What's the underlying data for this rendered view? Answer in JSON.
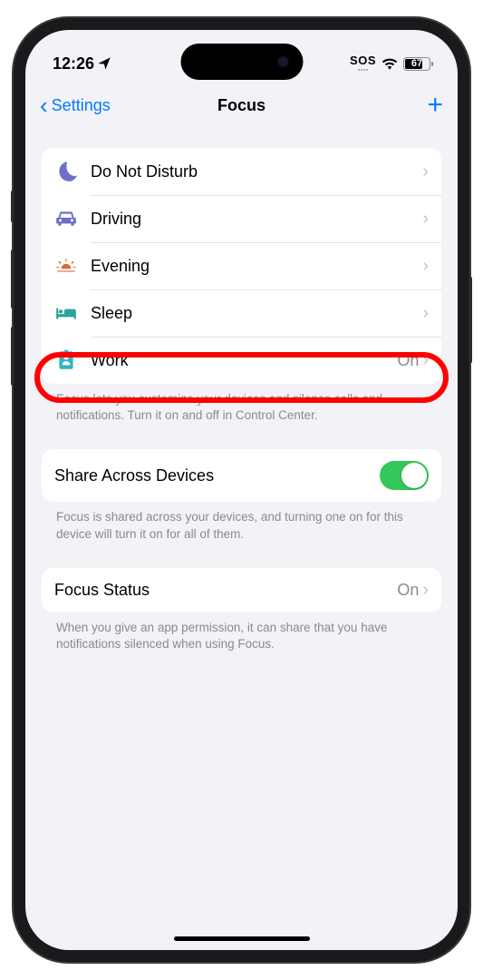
{
  "status_bar": {
    "time": "12:26",
    "sos": "SOS",
    "battery_percent": "67"
  },
  "nav": {
    "back_label": "Settings",
    "title": "Focus"
  },
  "focus_modes": [
    {
      "label": "Do Not Disturb",
      "status": ""
    },
    {
      "label": "Driving",
      "status": ""
    },
    {
      "label": "Evening",
      "status": ""
    },
    {
      "label": "Sleep",
      "status": ""
    },
    {
      "label": "Work",
      "status": "On"
    }
  ],
  "focus_footer": "Focus lets you customize your devices and silence calls and notifications. Turn it on and off in Control Center.",
  "share": {
    "label": "Share Across Devices",
    "footer": "Focus is shared across your devices, and turning one on for this device will turn it on for all of them."
  },
  "focus_status": {
    "label": "Focus Status",
    "value": "On",
    "footer": "When you give an app permission, it can share that you have notifications silenced when using Focus."
  }
}
